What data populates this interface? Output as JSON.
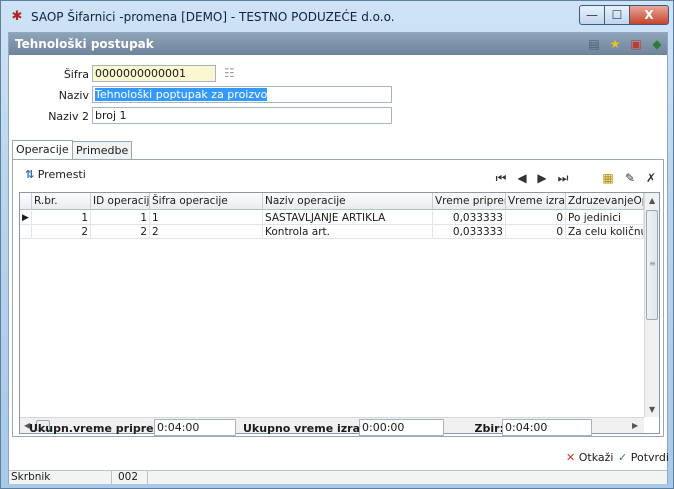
{
  "window": {
    "title": "SAOP Šifarnici -promena [DEMO] - TESTNO PODUZEĆE d.o.o.",
    "min_glyph": "—",
    "max_glyph": "☐",
    "close_glyph": "X"
  },
  "form": {
    "title": "Tehnološki postupak",
    "sifra_label": "Šifra",
    "sifra_value": "0000000000001",
    "naziv_label": "Naziv",
    "naziv_value": "Tehnološki poptupak za proizvo",
    "naziv2_label": "Naziv 2",
    "naziv2_value": "broj 1"
  },
  "tabs": [
    {
      "label": "Operacije",
      "active": true
    },
    {
      "label": "Primedbe",
      "active": false
    }
  ],
  "toolbar": {
    "premesti_label": "Premesti"
  },
  "grid": {
    "columns": [
      "R.br.",
      "ID operacije",
      "Šifra operacije",
      "Naziv operacije",
      "Vreme pripreme",
      "Vreme izrade",
      "ZdruzevanjeOperac"
    ],
    "rows": [
      [
        "1",
        "1",
        "1",
        "SASTAVLJANJE ARTIKLA",
        "0,033333",
        "0",
        "Po jedinici"
      ],
      [
        "2",
        "2",
        "2",
        "Kontrola art.",
        "0,033333",
        "0",
        "Za celu količnu"
      ]
    ]
  },
  "totals": {
    "priprema_label": "Ukupn.vreme pripreme:",
    "priprema_value": "0:04:00",
    "izrada_label": "Ukupno vreme izrade:",
    "izrada_value": "0:00:00",
    "zbir_label": "Zbir:",
    "zbir_value": "0:04:00"
  },
  "buttons": {
    "cancel_label": "Otkaži",
    "confirm_label": "Potvrdi"
  },
  "statusbar": {
    "user_label": "Skrbnik",
    "code": "002"
  },
  "colors": {
    "header_band": "#7d92a8",
    "selection": "#3399ff",
    "required_field": "#fbf7d0"
  }
}
